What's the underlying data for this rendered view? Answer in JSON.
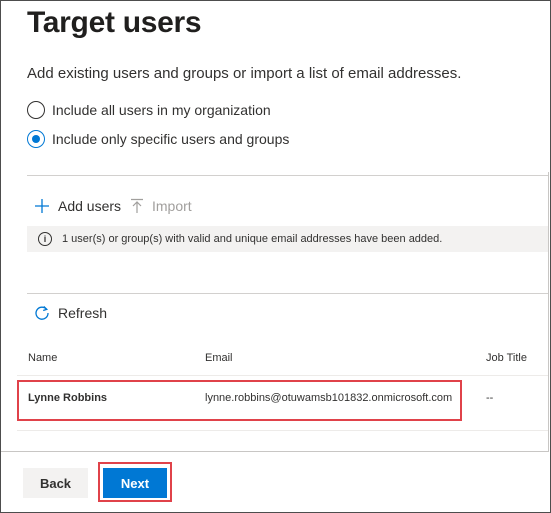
{
  "page": {
    "title": "Target users",
    "description": "Add existing users and groups or import a list of email addresses."
  },
  "options": {
    "all_users_label": "Include all users in my organization",
    "specific_users_label": "Include only specific users and groups",
    "selected": "specific"
  },
  "commands": {
    "add_users_label": "Add users",
    "import_label": "Import"
  },
  "info": {
    "message": "1 user(s) or group(s) with valid and unique email addresses have been added."
  },
  "refresh": {
    "label": "Refresh"
  },
  "table": {
    "headers": {
      "name": "Name",
      "email": "Email",
      "job_title": "Job Title"
    },
    "rows": [
      {
        "name": "Lynne Robbins",
        "email": "lynne.robbins@otuwamsb101832.onmicrosoft.com",
        "job_title": "--"
      }
    ]
  },
  "footer": {
    "back_label": "Back",
    "next_label": "Next"
  },
  "colors": {
    "accent": "#0078d4",
    "highlight": "#e0424a",
    "info_background": "#f3f2f1"
  }
}
